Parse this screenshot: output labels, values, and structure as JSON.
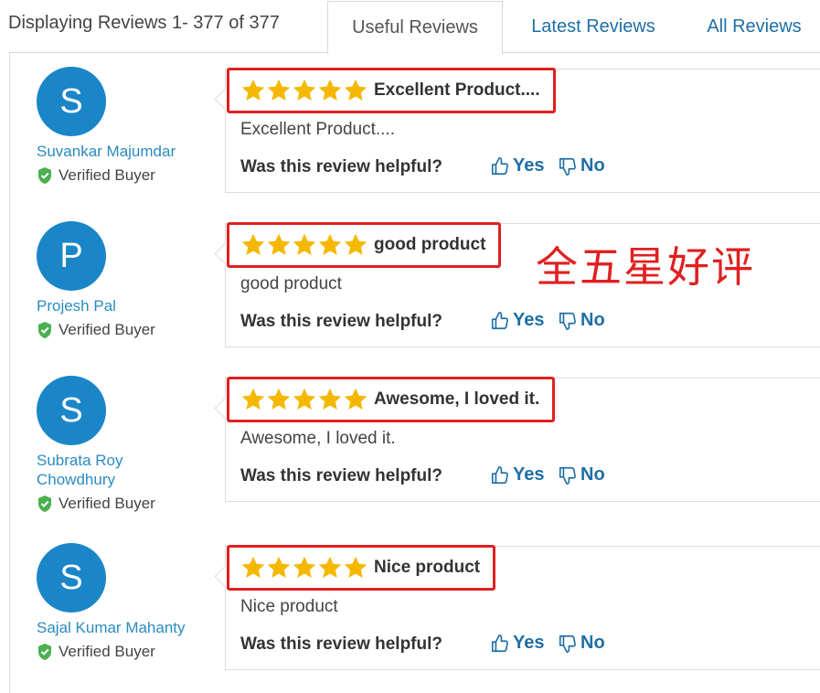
{
  "header": {
    "display_count": "Displaying Reviews 1- 377 of 377",
    "tabs": [
      {
        "label": "Useful Reviews",
        "active": true
      },
      {
        "label": "Latest Reviews",
        "active": false
      },
      {
        "label": "All Reviews",
        "active": false
      }
    ]
  },
  "common": {
    "verified_label": "Verified Buyer",
    "helpful_question": "Was this review helpful?",
    "yes_label": "Yes",
    "no_label": "No"
  },
  "reviews": [
    {
      "initial": "S",
      "name": "Suvankar Majumdar",
      "rating": 5,
      "title": "Excellent Product....",
      "body": "Excellent Product...."
    },
    {
      "initial": "P",
      "name": "Projesh Pal",
      "rating": 5,
      "title": "good product",
      "body": "good product"
    },
    {
      "initial": "S",
      "name": "Subrata Roy Chowdhury",
      "rating": 5,
      "title": "Awesome, I loved it.",
      "body": "Awesome, I loved it."
    },
    {
      "initial": "S",
      "name": "Sajal Kumar Mahanty",
      "rating": 5,
      "title": "Nice product",
      "body": "Nice product"
    }
  ],
  "annotation": "全五星好评",
  "colors": {
    "accent_blue": "#1f6fa5",
    "avatar_blue": "#1a86c8",
    "star_yellow": "#f5b800",
    "highlight_red": "#e02020",
    "verified_green": "#4caf50"
  }
}
